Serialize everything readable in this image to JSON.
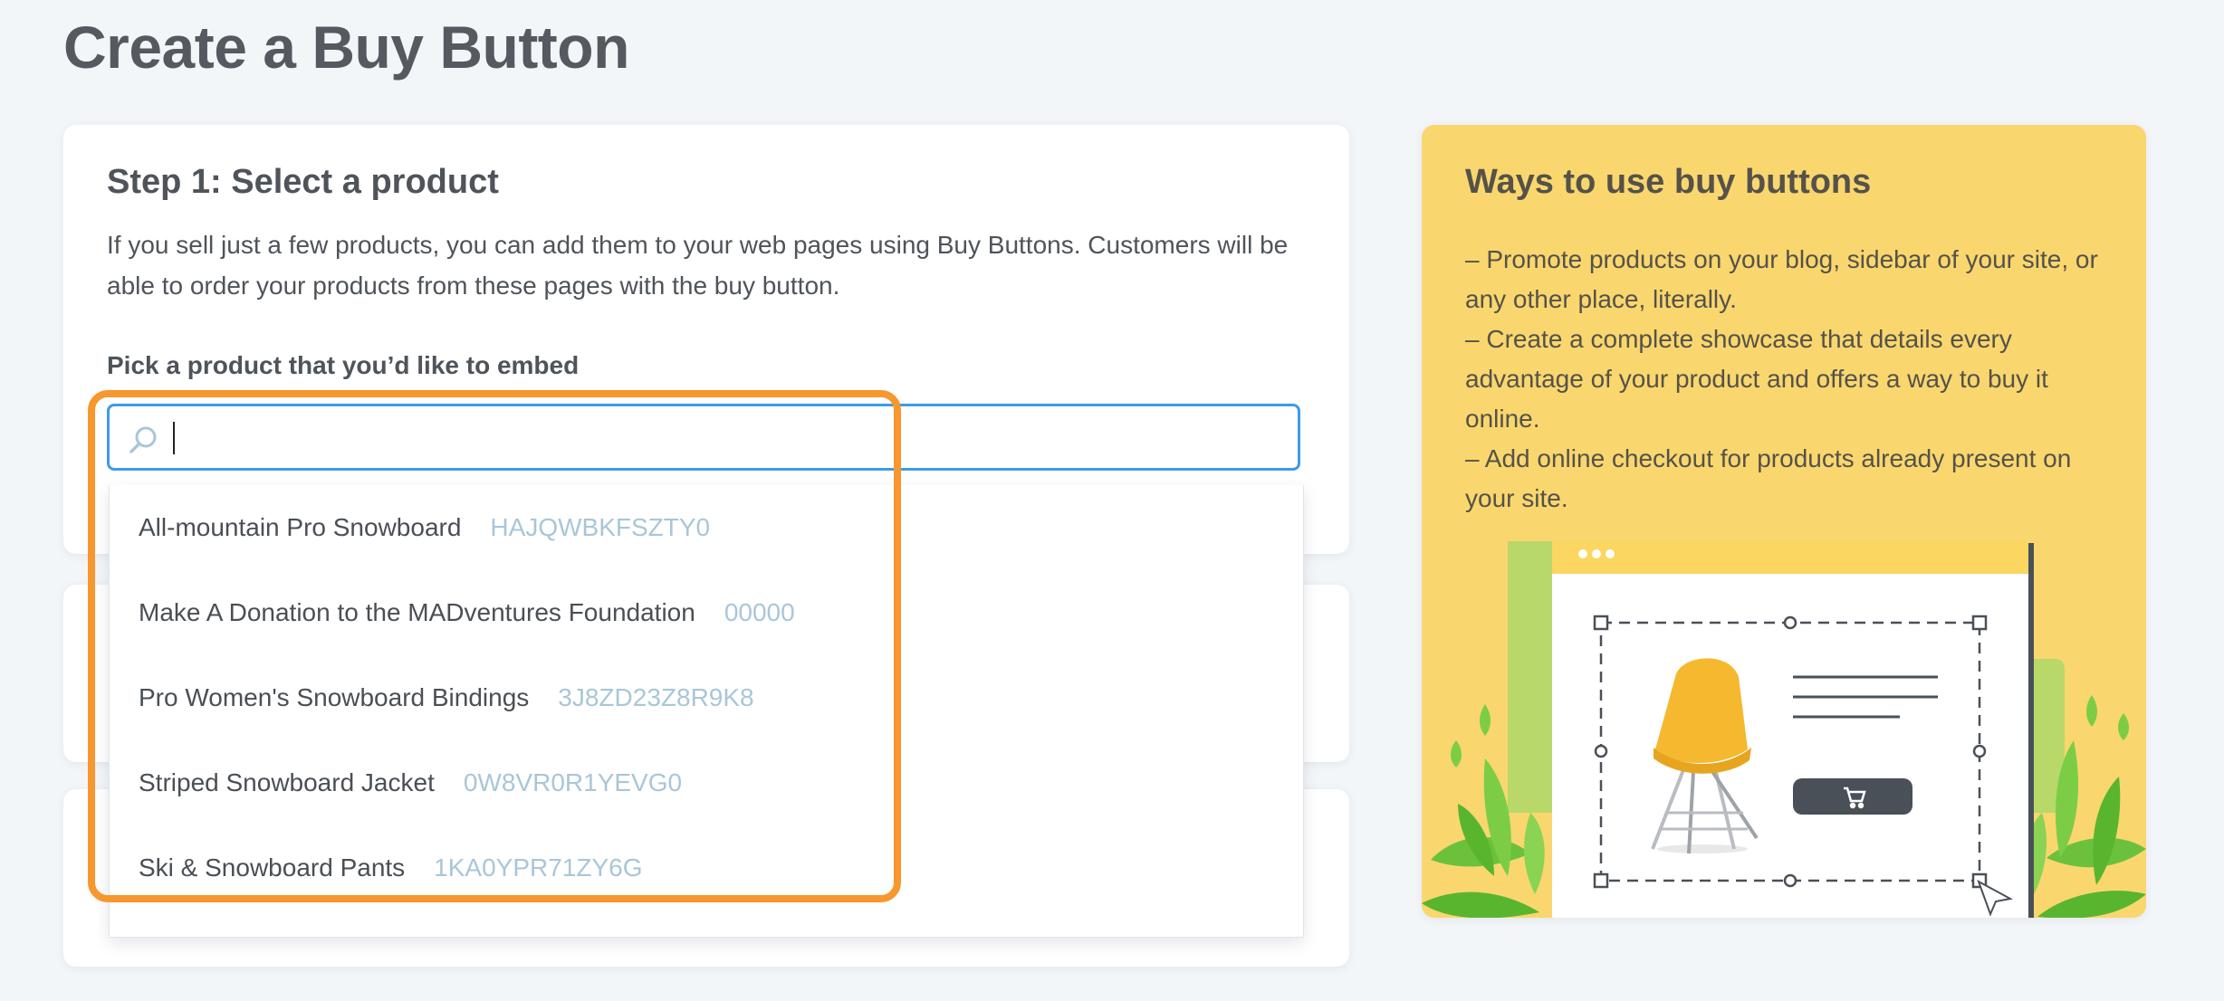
{
  "page": {
    "title": "Create a Buy Button"
  },
  "step1": {
    "title": "Step 1: Select a product",
    "description": "If you sell just a few products, you can add them to your web pages using Buy Buttons. Customers will be able to order your products from these pages with the buy button.",
    "field_label": "Pick a product that you’d like to embed",
    "search": {
      "value": "",
      "placeholder": "",
      "icon": "search-icon"
    },
    "products": [
      {
        "name": "All-mountain Pro Snowboard",
        "sku": "HAJQWBKFSZTY0"
      },
      {
        "name": "Make A Donation to the MADventures Foundation",
        "sku": "00000"
      },
      {
        "name": "Pro Women's Snowboard Bindings",
        "sku": "3J8ZD23Z8R9K8"
      },
      {
        "name": "Striped Snowboard Jacket",
        "sku": "0W8VR0R1YEVG0"
      },
      {
        "name": "Ski & Snowboard Pants",
        "sku": "1KA0YPR71ZY6G"
      }
    ]
  },
  "info": {
    "title": "Ways to use buy buttons",
    "bullets": [
      "– Promote products on your blog, sidebar of your site, or any other place, literally.",
      "– Create a complete showcase that details every advantage of your product and offers a way to buy it online.",
      "– Add online checkout for products already present on your site."
    ]
  },
  "colors": {
    "background": "#f3f6f9",
    "accent_blue": "#3d9be9",
    "highlight_orange": "#f7972e",
    "info_yellow": "#f9d76e",
    "sku_text": "#a9c6d8",
    "chair_yellow": "#f5b82e",
    "cart_button": "#4a5058"
  }
}
